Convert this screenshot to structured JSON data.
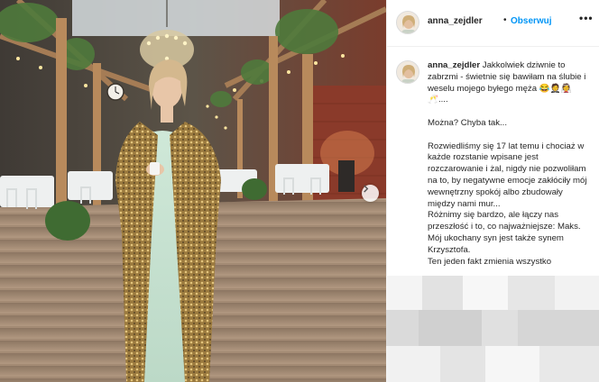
{
  "post": {
    "username": "anna_zejdler",
    "separator": "•",
    "follow_label": "Obserwuj",
    "more_icon": "more-options-icon",
    "caption": {
      "username": "anna_zejdler",
      "p1": "Jakkolwiek dziwnie to zabrzmi - świetnie się bawiłam na ślubie i weselu mojego byłego męża 😂🤵👰🥂....",
      "p2": "Można? Chyba tak...",
      "p3": "Rozwiedliśmy się 17 lat temu i chociaż w każde rozstanie wpisane jest rozczarowanie i żal, nigdy nie pozwoliłam na to, by negatywne emocje zakłóciły mój wewnętrzny spokój albo zbudowały między nami mur...",
      "p4": "Różnimy się bardzo, ale łączy nas przeszłość i to, co najważniejsze: Maks. Mój ukochany syn jest także synem Krzysztofa.",
      "p5": "Ten jeden fakt zmienia wszystko"
    }
  },
  "photo": {
    "next_icon": "chevron-right-icon"
  },
  "colors": {
    "accent": "#0095f6",
    "text": "#262626",
    "border": "#efefef"
  }
}
